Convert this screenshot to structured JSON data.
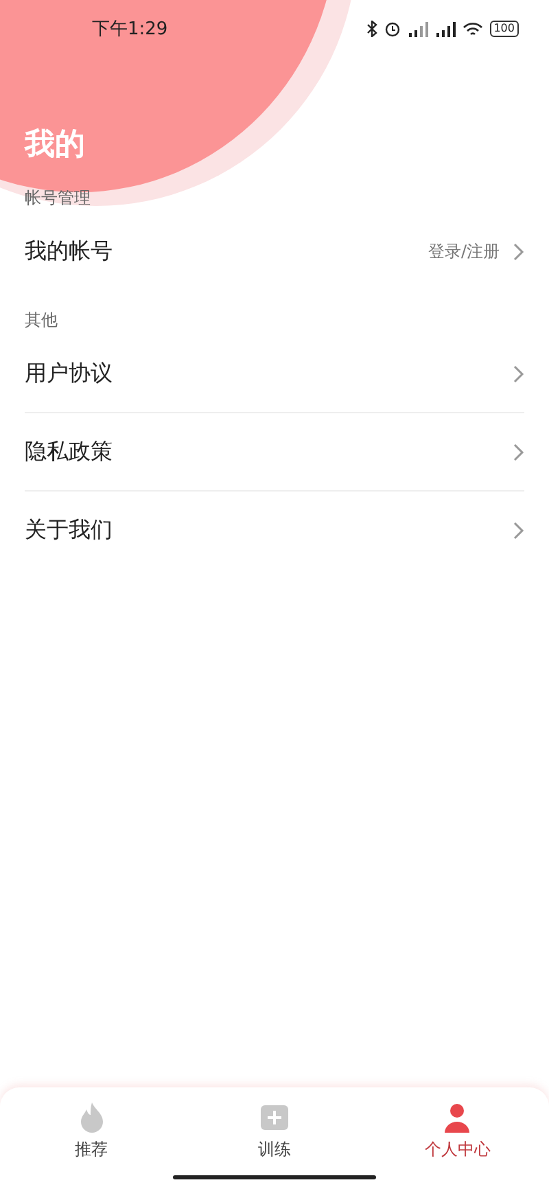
{
  "status_bar": {
    "time": "下午1:29",
    "battery": "100"
  },
  "header": {
    "title": "我的"
  },
  "sections": [
    {
      "title": "帐号管理",
      "items": [
        {
          "label": "我的帐号",
          "value": "登录/注册"
        }
      ]
    },
    {
      "title": "其他",
      "items": [
        {
          "label": "用户协议"
        },
        {
          "label": "隐私政策"
        },
        {
          "label": "关于我们"
        }
      ]
    }
  ],
  "tab_bar": [
    {
      "label": "推荐",
      "kind": "flame",
      "selected": false
    },
    {
      "label": "训练",
      "kind": "plus",
      "selected": false
    },
    {
      "label": "个人中心",
      "kind": "person",
      "selected": true
    }
  ]
}
